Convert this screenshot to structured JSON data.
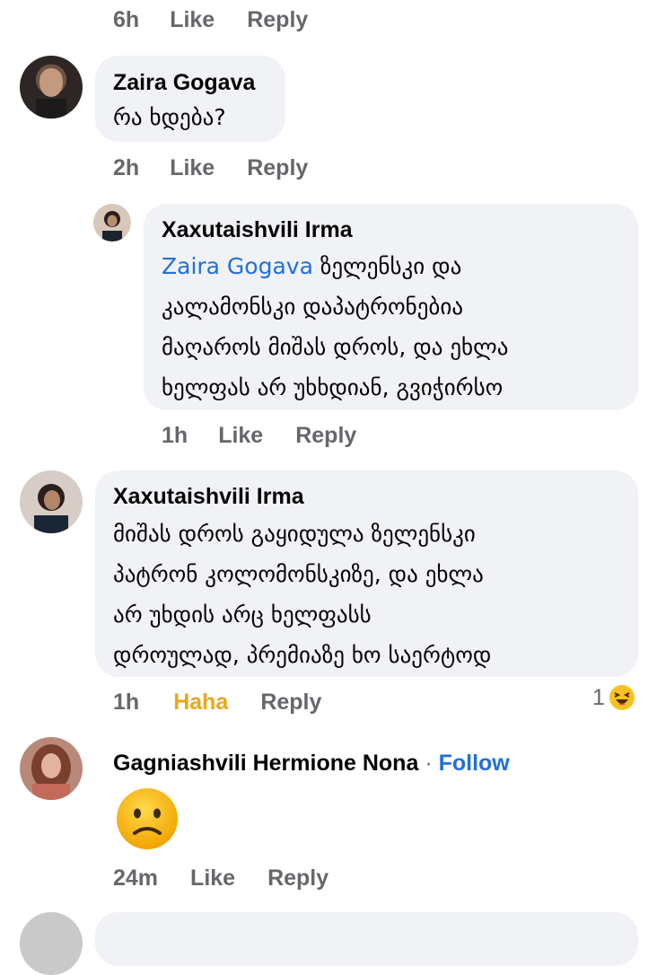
{
  "comments": [
    {
      "actions": {
        "time": "6h",
        "like": "Like",
        "reply": "Reply"
      }
    },
    {
      "author": "Zaira Gogava",
      "lines": [
        "რა ხდება?"
      ],
      "actions": {
        "time": "2h",
        "like": "Like",
        "reply": "Reply"
      }
    },
    {
      "author": "Xaxutaishvili Irma",
      "mention": "Zaira Gogava",
      "lines": [
        " ზელენსკი და",
        "კალამონსკი დაპატრონებია",
        "მაღაროს მიშას დროს, და ეხლა",
        "ხელფას არ უხხდიან, გვიჭირსო"
      ],
      "actions": {
        "time": "1h",
        "like": "Like",
        "reply": "Reply"
      }
    },
    {
      "author": "Xaxutaishvili Irma",
      "lines": [
        "მიშას დროს გაყიდულა ზელენსკი",
        "პატრონ კოლომონსკიზე, და ეხლა",
        "არ უხდის არც ხელფასს",
        "დროულად, პრემიაზე ხო საერტოდ"
      ],
      "actions": {
        "time": "1h",
        "like": "Haha",
        "reply": "Reply"
      },
      "reaction_count": "1",
      "reaction_icon": "haha-emoji-icon"
    },
    {
      "author": "Gagniashvili Hermione Nona",
      "separator": "·",
      "follow": "Follow",
      "sticker": "confused-face-emoji",
      "actions": {
        "time": "24m",
        "like": "Like",
        "reply": "Reply"
      }
    }
  ],
  "colors": {
    "bubble": "#f0f2f5",
    "link": "#216fdb",
    "meta": "#65676b",
    "haha": "#e8a915"
  }
}
